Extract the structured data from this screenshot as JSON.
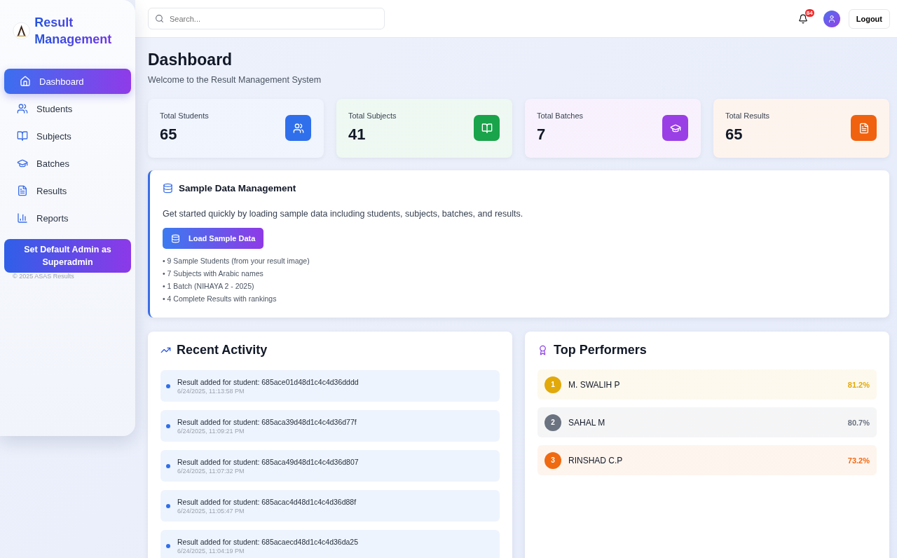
{
  "sidebar": {
    "brand": "Result Management",
    "items": [
      {
        "label": "Dashboard",
        "kind": "home",
        "selected": true
      },
      {
        "label": "Students",
        "kind": "users",
        "selected": false
      },
      {
        "label": "Subjects",
        "kind": "book",
        "selected": false
      },
      {
        "label": "Batches",
        "kind": "cap",
        "selected": false
      },
      {
        "label": "Results",
        "kind": "file",
        "selected": false
      },
      {
        "label": "Reports",
        "kind": "chart",
        "selected": false
      }
    ],
    "admin_button": "Set Default Admin as Superadmin",
    "footer": "© 2025 ASAS Results"
  },
  "topbar": {
    "search": {
      "placeholder": "Search..."
    },
    "notifications": "84",
    "logout": "Logout"
  },
  "page": {
    "title": "Dashboard",
    "subtitle": "Welcome to the Result Management System"
  },
  "stats": [
    {
      "label": "Total Students",
      "value": "65",
      "kind": "users",
      "color": "#2f6fec"
    },
    {
      "label": "Total Subjects",
      "value": "41",
      "kind": "book",
      "color": "#19a34a"
    },
    {
      "label": "Total Batches",
      "value": "7",
      "kind": "cap",
      "color": "#9a3fe6"
    },
    {
      "label": "Total Results",
      "value": "65",
      "kind": "file",
      "color": "#f0620f"
    }
  ],
  "sample": {
    "title": "Sample Data Management",
    "text": "Get started quickly by loading sample data including students, subjects, batches, and results.",
    "button": "Load Sample Data",
    "bullets": [
      "• 9 Sample Students (from your result image)",
      "• 7 Subjects with Arabic names",
      "• 1 Batch (NIHAYA 2 - 2025)",
      "• 4 Complete Results with rankings"
    ]
  },
  "activity": {
    "title": "Recent Activity",
    "items": [
      {
        "text": "Result added for student: 685ace01d48d1c4c4d36dddd",
        "time": "6/24/2025, 11:13:58 PM"
      },
      {
        "text": "Result added for student: 685aca39d48d1c4c4d36d77f",
        "time": "6/24/2025, 11:09:21 PM"
      },
      {
        "text": "Result added for student: 685aca49d48d1c4c4d36d807",
        "time": "6/24/2025, 11:07:32 PM"
      },
      {
        "text": "Result added for student: 685acac4d48d1c4c4d36d88f",
        "time": "6/24/2025, 11:05:47 PM"
      },
      {
        "text": "Result added for student: 685acaecd48d1c4c4d36da25",
        "time": "6/24/2025, 11:04:19 PM"
      }
    ]
  },
  "performers": {
    "title": "Top Performers",
    "items": [
      {
        "rank": "1",
        "name": "M. SWALIH P",
        "score": "81.2%",
        "color": "#e2a90b"
      },
      {
        "rank": "2",
        "name": "SAHAL M",
        "score": "80.7%",
        "color": "#6b7280"
      },
      {
        "rank": "3",
        "name": "RINSHAD C.P",
        "score": "73.2%",
        "color": "#f06a12"
      }
    ]
  }
}
